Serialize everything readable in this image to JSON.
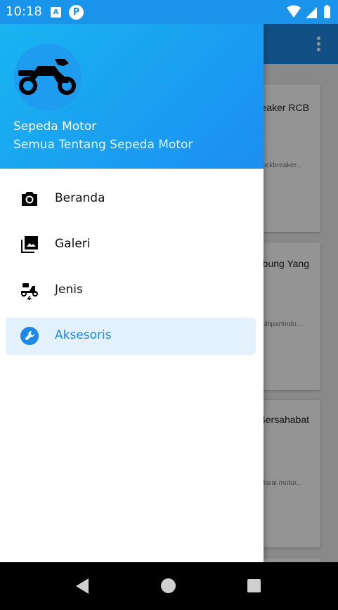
{
  "status_bar": {
    "time": "10:18",
    "icon_a": "A",
    "icon_p": "P",
    "icons": [
      "text-icon",
      "notification-p-icon",
      "wifi-icon",
      "signal-icon",
      "battery-icon"
    ]
  },
  "drawer": {
    "header": {
      "title": "Sepeda Motor",
      "subtitle": "Semua Tentang Sepeda Motor",
      "avatar_icon": "motorcycle-icon"
    },
    "items": [
      {
        "label": "Beranda",
        "icon": "camera-icon",
        "active": false
      },
      {
        "label": "Galeri",
        "icon": "photo-library-icon",
        "active": false
      },
      {
        "label": "Jenis",
        "icon": "electric-moped-icon",
        "active": false
      },
      {
        "label": "Aksesoris",
        "icon": "wrench-icon",
        "active": true
      }
    ]
  },
  "background_cards": [
    {
      "title": "kbreaker RCB",
      "subtitle": "hockbreaker..."
    },
    {
      "title": "a Tabung Yang",
      "subtitle": "Multipartindo..."
    },
    {
      "title": "an Bersahabat",
      "subtitle": "ndarai motor..."
    }
  ],
  "colors": {
    "primary": "#1e88e5",
    "status_bar": "#1a93ea",
    "active_bg": "#e3f1fd",
    "header_gradient_start": "#18b5f0",
    "header_gradient_end": "#1b8ef2"
  }
}
